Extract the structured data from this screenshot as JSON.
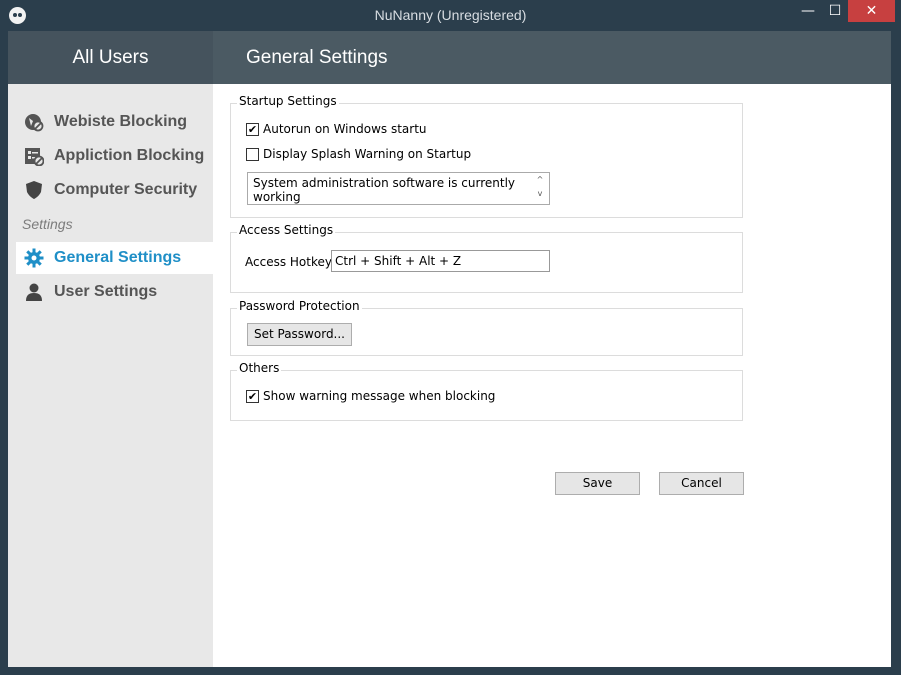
{
  "window": {
    "title": "NuNanny  (Unregistered)",
    "minimize_glyph": "—",
    "maximize_glyph": "☐",
    "close_glyph": "✕"
  },
  "header": {
    "left": "All Users",
    "right": "General Settings"
  },
  "sidebar": {
    "items": [
      {
        "label": "Webiste Blocking",
        "icon": "globe-block-icon"
      },
      {
        "label": "Appliction Blocking",
        "icon": "app-list-icon"
      },
      {
        "label": "Computer Security",
        "icon": "shield-icon"
      }
    ],
    "section_label": "Settings",
    "settings_items": [
      {
        "label": "General Settings",
        "icon": "gear-icon",
        "active": true
      },
      {
        "label": "User Settings",
        "icon": "user-icon"
      }
    ]
  },
  "startup": {
    "legend": "Startup Settings",
    "autorun_label": "Autorun on Windows startu",
    "autorun_checked": true,
    "splash_label": "Display Splash Warning on Startup",
    "splash_checked": false,
    "message": "System administration software is currently working"
  },
  "access": {
    "legend": "Access Settings",
    "hotkey_label": "Access Hotkey",
    "hotkey_value": "Ctrl + Shift + Alt + Z"
  },
  "password": {
    "legend": "Password Protection",
    "set_button": "Set Password..."
  },
  "others": {
    "legend": "Others",
    "warning_label": "Show warning message when blocking",
    "warning_checked": true
  },
  "buttons": {
    "save": "Save",
    "cancel": "Cancel"
  },
  "colors": {
    "accent": "#1f8fc7",
    "header_dark": "#45535d",
    "sidebar_bg": "#e8e8e8"
  }
}
